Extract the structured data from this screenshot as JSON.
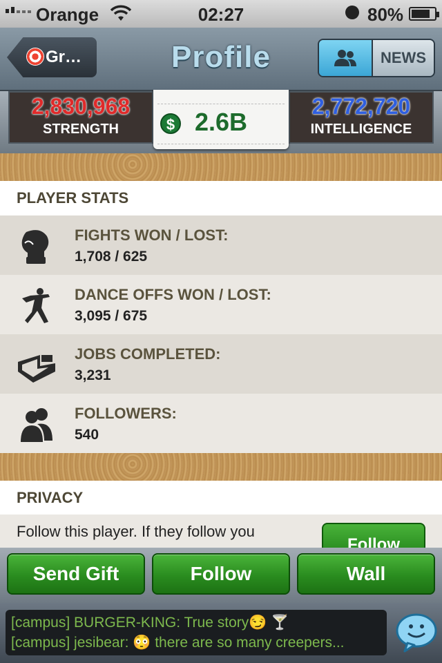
{
  "status_bar": {
    "carrier": "Orange",
    "time": "02:27",
    "battery": "80%"
  },
  "nav": {
    "back_label": "Gr…",
    "title": "Profile",
    "news_label": "NEWS"
  },
  "stats_header": {
    "strength_value": "2,830,968",
    "strength_label": "STRENGTH",
    "cash_value": "2.6B",
    "cash_symbol": "$",
    "intelligence_value": "2,772,720",
    "intelligence_label": "INTELLIGENCE"
  },
  "player_stats": {
    "heading": "PLAYER STATS",
    "rows": [
      {
        "icon": "boxing-glove-icon",
        "label": "FIGHTS WON / LOST:",
        "value": "1,708 / 625"
      },
      {
        "icon": "dancer-icon",
        "label": "DANCE OFFS WON / LOST:",
        "value": "3,095 / 675"
      },
      {
        "icon": "laptop-icon",
        "label": "JOBS COMPLETED:",
        "value": "3,231"
      },
      {
        "icon": "people-icon",
        "label": "FOLLOWERS:",
        "value": "540"
      }
    ]
  },
  "privacy": {
    "heading": "PRIVACY",
    "text": "Follow this player. If they follow you",
    "follow_label": "Follow"
  },
  "actions": {
    "send_gift": "Send Gift",
    "follow": "Follow",
    "wall": "Wall"
  },
  "chat": {
    "line1": "[campus] BURGER-KING: True story😏 🍸",
    "line2": "[campus] jesibear: 😳 there are so many creepers..."
  },
  "colors": {
    "strength": "#e02a2a",
    "intelligence": "#2f5fe0",
    "cash": "#1d6b2c",
    "button_green": "#2a8c1f",
    "chat_text": "#7db94d"
  }
}
